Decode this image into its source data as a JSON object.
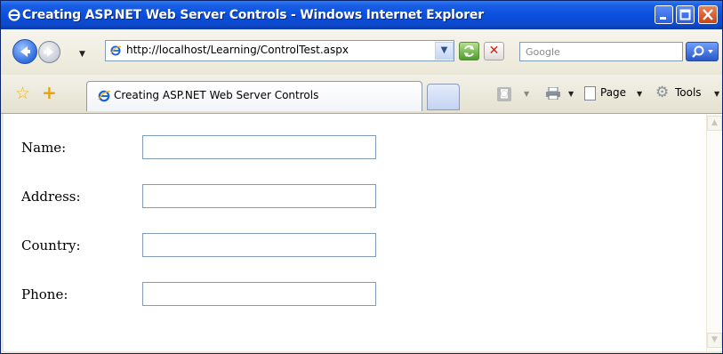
{
  "window": {
    "title": "Creating ASP.NET Web Server Controls - Windows Internet Explorer"
  },
  "toolbar": {
    "address": "http://localhost/Learning/ControlTest.aspx",
    "search_placeholder": "Google"
  },
  "tabs": [
    {
      "label": "Creating ASP.NET Web Server Controls",
      "active": true
    }
  ],
  "command_bar": {
    "page_label": "Page",
    "tools_label": "Tools"
  },
  "form": {
    "fields": [
      {
        "label": "Name:",
        "value": ""
      },
      {
        "label": "Address:",
        "value": ""
      },
      {
        "label": "Country:",
        "value": ""
      },
      {
        "label": "Phone:",
        "value": ""
      }
    ]
  },
  "colors": {
    "titlebar": "#0a4fe0",
    "close_button": "#c74419",
    "input_border": "#7f9db9"
  }
}
